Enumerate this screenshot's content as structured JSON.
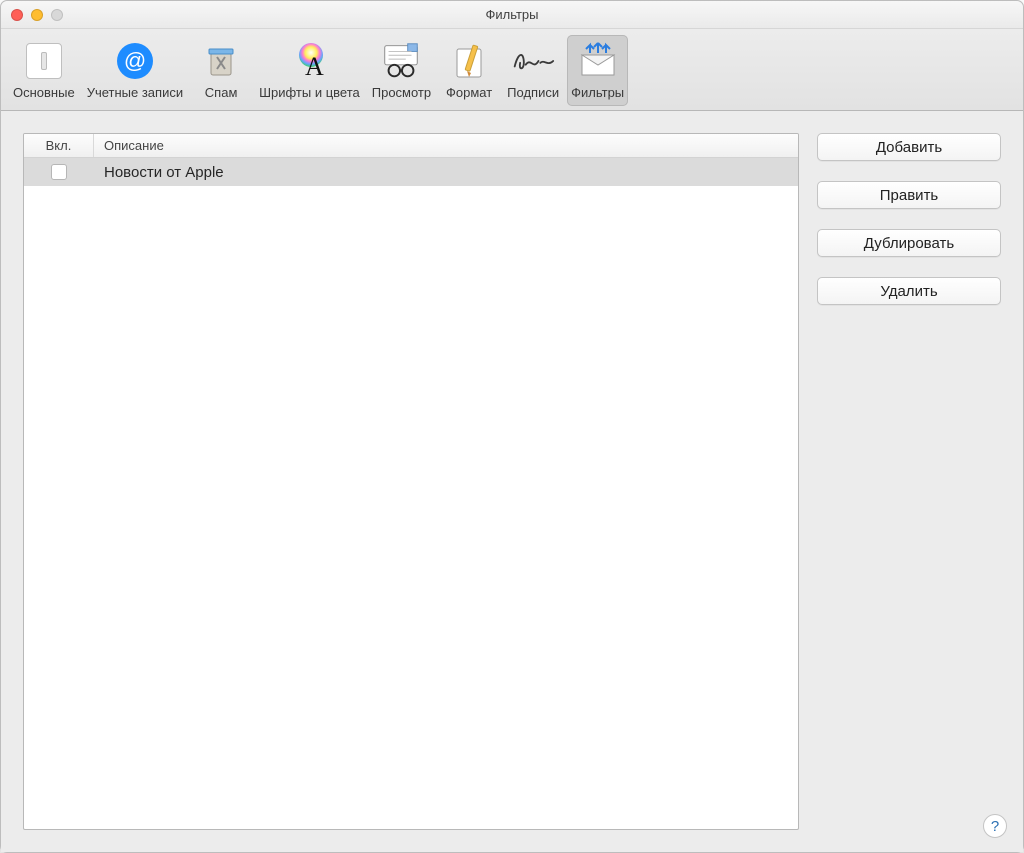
{
  "window": {
    "title": "Фильтры"
  },
  "toolbar": [
    {
      "key": "general",
      "label": "Основные"
    },
    {
      "key": "accounts",
      "label": "Учетные записи"
    },
    {
      "key": "junk",
      "label": "Спам"
    },
    {
      "key": "fonts",
      "label": "Шрифты и цвета"
    },
    {
      "key": "viewing",
      "label": "Просмотр"
    },
    {
      "key": "composing",
      "label": "Формат"
    },
    {
      "key": "signatures",
      "label": "Подписи"
    },
    {
      "key": "rules",
      "label": "Фильтры",
      "selected": true
    }
  ],
  "columns": {
    "on": "Вкл.",
    "desc": "Описание"
  },
  "rules": [
    {
      "enabled": false,
      "desc": "Новости от Apple",
      "selected": true
    }
  ],
  "buttons": {
    "add": "Добавить",
    "edit": "Править",
    "duplicate": "Дублировать",
    "delete": "Удалить"
  },
  "help_label": "?"
}
